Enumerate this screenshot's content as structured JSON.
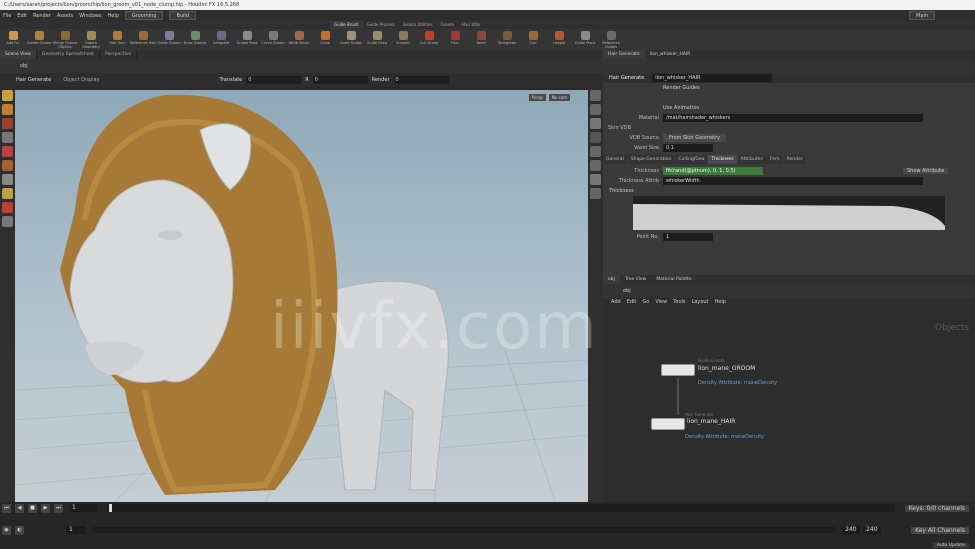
{
  "window": {
    "title": "C:/Users/sarah/projects/lion/groom/hip/lion_groom_v01_node_clump.hip - Houdini FX 16.5.268"
  },
  "menu": {
    "items": [
      "File",
      "Edit",
      "Render",
      "Assets",
      "Windows",
      "Help"
    ],
    "desktop": "Grooming",
    "toolbar": "Build",
    "main_label": "Main"
  },
  "shelf_tabs": [
    "Guide Brush",
    "Guide Process",
    "Groom Utilities",
    "Groom",
    "Hair Utils"
  ],
  "shelf_tools": [
    {
      "label": "Add Fur",
      "color": "#c69a4c"
    },
    {
      "label": "Create Groom",
      "color": "#b08040"
    },
    {
      "label": "Merge Groom Objects",
      "color": "#8a6a3a"
    },
    {
      "label": "Groom Geometry",
      "color": "#a08a5a"
    },
    {
      "label": "Hair Gen",
      "color": "#b07a3a"
    },
    {
      "label": "Reference Hair",
      "color": "#9a6a3a"
    },
    {
      "label": "Guide Groom",
      "color": "#7a7a9a"
    },
    {
      "label": "Draw Groups",
      "color": "#6a8a6a"
    },
    {
      "label": "Integrate",
      "color": "#6a6a8a"
    },
    {
      "label": "Groom Pose",
      "color": "#8a8a8a"
    },
    {
      "label": "Curve Groom",
      "color": "#7a7a7a"
    },
    {
      "label": "Attrib Brush",
      "color": "#a06a4a"
    },
    {
      "label": "Comb",
      "color": "#c07030"
    },
    {
      "label": "Scale Sculpt",
      "color": "#a09080"
    },
    {
      "label": "Guide Draw",
      "color": "#9a8a6a"
    },
    {
      "label": "Smooth",
      "color": "#8a7a5a"
    },
    {
      "label": "Cut Clump",
      "color": "#c04030"
    },
    {
      "label": "Frizz",
      "color": "#a03a3a"
    },
    {
      "label": "Bend",
      "color": "#8a4a3a"
    },
    {
      "label": "Straighten",
      "color": "#7a5a3a"
    },
    {
      "label": "Curl",
      "color": "#9a6a3a"
    },
    {
      "label": "Length",
      "color": "#b05a3a"
    },
    {
      "label": "Guide Plant",
      "color": "#8a8a8a"
    },
    {
      "label": "Reference Guides",
      "color": "#6a6a6a"
    }
  ],
  "pane_tabs": [
    "Scene View",
    "Geometry Spreadsheet",
    "Perspective"
  ],
  "path": "obj",
  "op_bar": {
    "node": "Hair Generate",
    "display": "Object Display",
    "params": [
      {
        "label": "Translate",
        "value": "0"
      },
      {
        "label": "R",
        "value": "0"
      },
      {
        "label": "Render",
        "value": "0"
      }
    ]
  },
  "viewport": {
    "buttons": [
      "Persp",
      "No cam"
    ]
  },
  "watermark": "iiivfx.com",
  "timeline": {
    "frame": "1",
    "start": "1",
    "end": "240",
    "end2": "240",
    "ticks": [
      "1",
      "24",
      "48",
      "72",
      "96",
      "120",
      "144",
      "168",
      "192",
      "216",
      "240"
    ],
    "keys_label": "Keys: 0/0 channels",
    "key_all": "Key All Channels",
    "auto_update": "Auto Update"
  },
  "params": {
    "tabs_top": [
      "Hair Generate",
      "lion_whisker_HAIR"
    ],
    "node_type": "Hair Generate",
    "node_name": "lion_whisker_HAIR",
    "render_guides": "Render Guides",
    "use_animation": "Use Animation",
    "material_label": "Material",
    "material": "/mat/hairshader_whiskers",
    "section": "Skin VDB",
    "vdb_source_label": "VDB Source",
    "vdb_source": "From Skin Geometry",
    "voxel_size_label": "Voxel Size",
    "voxel_size": "0.1",
    "tabs": [
      "General",
      "Shape Generation",
      "Culling/Geo",
      "Thickness",
      "Attributes",
      "Fern",
      "Render"
    ],
    "thickness_label": "Thickness",
    "thickness_expr": "fit(rand(@ptnum), 0, 1, 0.5)",
    "show_attr": "Show Attribute",
    "thickness_attr_label": "Thickness Attrib",
    "thickness_attr": "whiskerWidth",
    "ramp_label": "Thickness",
    "point_no_label": "Point No.",
    "point_no": "1"
  },
  "network": {
    "tabs": [
      "obj",
      "Tree View",
      "Material Palette"
    ],
    "path": "obj",
    "menu": [
      "Add",
      "Edit",
      "Go",
      "View",
      "Tools",
      "Layout",
      "Help"
    ],
    "context": "Objects",
    "nodes": [
      {
        "tag": "Guide Groom",
        "name": "lion_mane_GROOM",
        "sub": "Density Attribute: maneDensity"
      },
      {
        "tag": "Hair Generate",
        "name": "lion_mane_HAIR",
        "sub": "Density Attribute: maneDensity"
      }
    ]
  }
}
